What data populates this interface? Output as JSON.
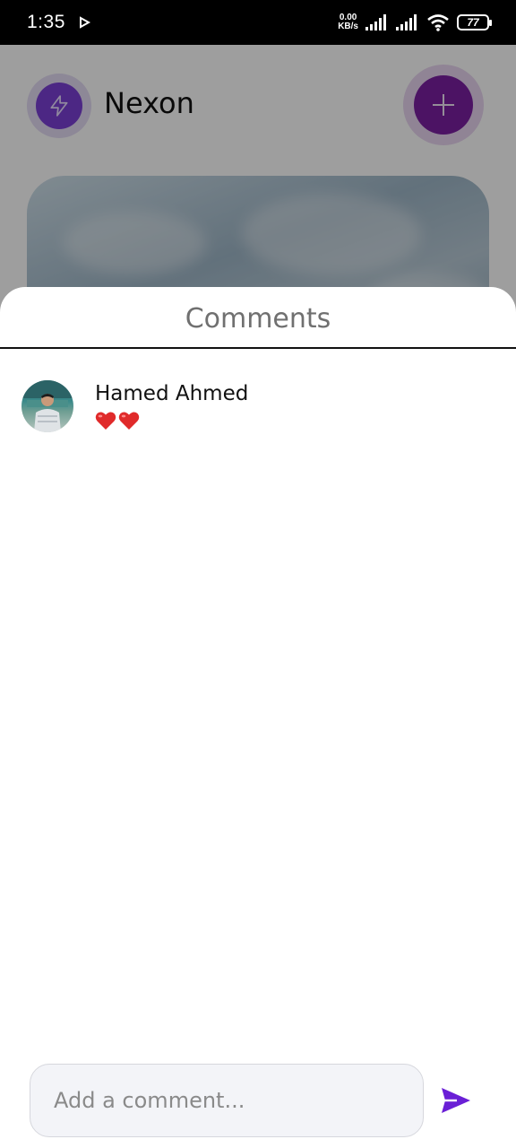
{
  "status_bar": {
    "time": "1:35",
    "net_speed_value": "0.00",
    "net_speed_unit": "KB/s",
    "battery": "77",
    "icons": [
      "play-icon",
      "signal-icon",
      "signal-icon",
      "wifi-icon",
      "battery-icon"
    ]
  },
  "app": {
    "title": "Nexon",
    "logo_icon": "bolt-icon",
    "add_icon": "plus-icon"
  },
  "sheet": {
    "title": "Comments",
    "comments": [
      {
        "author": "Hamed Ahmed",
        "text": "❤️❤️"
      }
    ]
  },
  "composer": {
    "placeholder": "Add a comment...",
    "value": "",
    "send_icon": "send-icon"
  },
  "colors": {
    "accent": "#7b1fa2",
    "send": "#6a1fd6",
    "logo": "#7b3fd6"
  }
}
